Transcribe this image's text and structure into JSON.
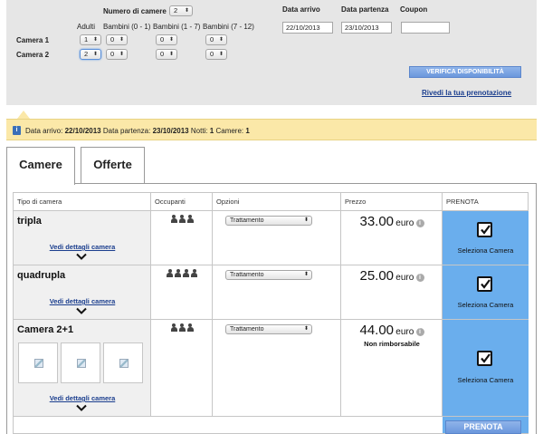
{
  "search": {
    "num_rooms_label": "Numero di camere",
    "num_rooms_value": "2",
    "headers": {
      "adults": "Adulti",
      "children_0_1": "Bambini (0 - 1)",
      "children_1_7": "Bambini (1 - 7)",
      "children_7_12": "Bambini (7 - 12)"
    },
    "rooms": [
      {
        "label": "Camera 1",
        "adults": "1",
        "c01": "0",
        "c17": "0",
        "c712": "0"
      },
      {
        "label": "Camera 2",
        "adults": "2",
        "c01": "0",
        "c17": "0",
        "c712": "0"
      }
    ],
    "arrival_label": "Data arrivo",
    "arrival_value": "22/10/2013",
    "departure_label": "Data partenza",
    "departure_value": "23/10/2013",
    "coupon_label": "Coupon",
    "coupon_value": "",
    "verify_button": "VERIFICA DISPONIBILITÀ",
    "review_link": "Rivedi la tua prenotazione"
  },
  "info_bar": {
    "arrival_label": "Data arrivo:",
    "arrival_value": "22/10/2013",
    "departure_label": "Data partenza:",
    "departure_value": "23/10/2013",
    "nights_label": "Notti:",
    "nights_value": "1",
    "rooms_label": "Camere:",
    "rooms_value": "1"
  },
  "tabs": [
    {
      "label": "Camere",
      "active": true
    },
    {
      "label": "Offerte",
      "active": false
    }
  ],
  "table": {
    "headers": [
      "Tipo di camera",
      "Occupanti",
      "Opzioni",
      "Prezzo",
      "PRENOTA"
    ],
    "rows": [
      {
        "name": "tripla",
        "occupants": 3,
        "option": "Trattamento",
        "price": "33.00",
        "currency": "euro",
        "note": "",
        "details_link": "Vedi dettagli camera",
        "select_label": "Seleziona Camera",
        "selected": true
      },
      {
        "name": "quadrupla",
        "occupants": 4,
        "option": "Trattamento",
        "price": "25.00",
        "currency": "euro",
        "note": "",
        "details_link": "Vedi dettagli camera",
        "select_label": "Seleziona Camera",
        "selected": true
      },
      {
        "name": "Camera 2+1",
        "occupants": 3,
        "option": "Trattamento",
        "price": "44.00",
        "currency": "euro",
        "note": "Non rimborsabile",
        "details_link": "Vedi dettagli camera",
        "select_label": "Seleziona Camera",
        "selected": true,
        "thumbnails": 3
      }
    ]
  },
  "book_button": "PRENOTA",
  "colors": {
    "panel_bg": "#e6e6e6",
    "info_bg": "#fbe8a8",
    "book_column": "#6aaeed",
    "link": "#1b3e8e",
    "button": "#6b97dc"
  }
}
